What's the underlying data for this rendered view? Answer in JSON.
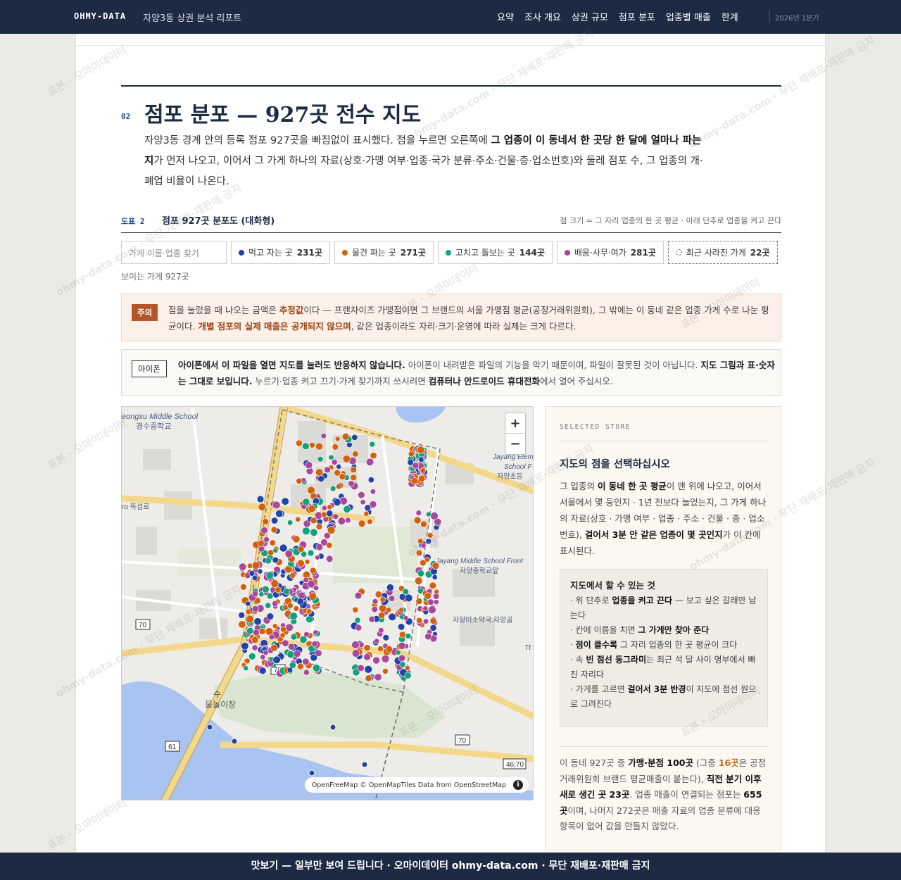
{
  "nav": {
    "brand": "OHMY-DATA",
    "report_title": "자양3동 상권 분석 리포트",
    "links": [
      "요약",
      "조사 개요",
      "상권 규모",
      "점포 분포",
      "업종별 매출",
      "한계"
    ],
    "period": "2026년 1분기"
  },
  "section": {
    "number": "02",
    "title": "점포 분포 — 927곳 전수 지도",
    "lede_1": "자양3동 경계 안의 등록 점포 927곳을 빠짐없이 표시했다. 점을 누르면 오른쪽에 ",
    "lede_bold": "그 업종이 이 동네서 한 곳당 한 달에 얼마나 파는지",
    "lede_2": "가 먼저 나오고, 이어서 그 가게 하나의 자료(상호·가맹 여부·업종·국가 분류·주소·건물·층·업소번호)와 둘레 점포 수, 그 업종의 개·폐업 비율이 나온다."
  },
  "figure": {
    "number": "도표 2",
    "title": "점포 927곳 분포도 (대화형)",
    "note": "점 크기 = 그 자리 업종의 한 곳 평균 · 아래 단추로 업종을 켜고 끈다"
  },
  "filters": {
    "search_placeholder": "가게 이름·업종 찾기",
    "chips": [
      {
        "label": "먹고 자는 곳",
        "count": "231곳",
        "color": "#2244aa"
      },
      {
        "label": "물건 파는 곳",
        "count": "271곳",
        "color": "#d0620e"
      },
      {
        "label": "고치고 돌보는 곳",
        "count": "144곳",
        "color": "#14a07a"
      },
      {
        "label": "배움·사무·여가",
        "count": "281곳",
        "color": "#a8489a"
      },
      {
        "label": "최근 사라진 가게",
        "count": "22곳",
        "color": "#666666"
      }
    ],
    "visible_count": "보이는 가게 927곳"
  },
  "warning": {
    "badge": "주의",
    "text_1": "점을 눌렀을 때 나오는 금액은 ",
    "bold_1": "추정값",
    "text_2": "이다 — 프랜차이즈 가맹점이면 그 브랜드의 서울 가맹점 평균(공정거래위원회), 그 밖에는 이 동네 같은 업종 가게 수로 나눈 평균이다. ",
    "bold_2": "개별 점포의 실제 매출은 공개되지 않으며",
    "text_3": ", 같은 업종이라도 자리·크기·운영에 따라 실제는 크게 다르다."
  },
  "ios": {
    "badge": "아이폰",
    "bold_1": "아이폰에서 이 파일을 열면 지도를 눌러도 반응하지 않습니다.",
    "text_1": " 아이폰이 내려받은 파일의 기능을 막기 때문이며, 파일이 잘못된 것이 아닙니다. ",
    "bold_2": "지도 그림과 표·숫자는 그대로 보입니다.",
    "text_2": " 누르기·업종 켜고 끄기·가게 찾기까지 쓰시려면 ",
    "bold_3": "컴퓨터나 안드로이드 휴대전화",
    "text_3": "에서 열어 주십시오."
  },
  "map": {
    "zoom_in": "+",
    "zoom_out": "−",
    "attribution": "OpenFreeMap © OpenMapTiles Data from OpenStreetMap",
    "labels": {
      "school_en": "eongsu Middle School",
      "school_kr": "경수중학교",
      "elem_en": "Jayang Elem",
      "elem_en2": "School F",
      "elem_kr": "자양초등",
      "mid_en": "Jayang Middle School Front",
      "mid_kr": "자양중학교앞",
      "bus_kr": "자양미소약국.자양골",
      "road_kr": "ro 뚝섬로",
      "park_kr1": "수",
      "park_kr2": "물놀이장",
      "road_70": "70",
      "road_61": "61",
      "road_4670": "46;70",
      "tt": "Tt"
    },
    "legend_colors": {
      "food": "#2244aa",
      "retail": "#d0620e",
      "service": "#14a07a",
      "office": "#a8489a"
    }
  },
  "panel": {
    "kicker": "SELECTED STORE",
    "title": "지도의 점을 선택하십시오",
    "desc_1": "그 업종의 ",
    "desc_b1": "이 동네 한 곳 평균",
    "desc_2": "이 맨 위에 나오고, 이어서 서울에서 몇 등인지 · 1년 전보다 늘었는지, 그 가게 하나의 자료(상호 · 가맹 여부 · 업종 · 주소 · 건물 · 층 · 업소번호), ",
    "desc_b2": "걸어서 3분 안 같은 업종이 몇 곳인지",
    "desc_3": "가 이 칸에 표시된다.",
    "howto_title": "지도에서 할 수 있는 것",
    "howto": [
      {
        "pre": "· 위 단추로 ",
        "bold": "업종을 켜고 끈다",
        "post": " — 보고 싶은 갈래만 남는다"
      },
      {
        "pre": "· 칸에 이름을 치면 ",
        "bold": "그 가게만 찾아 준다",
        "post": ""
      },
      {
        "pre": "· ",
        "bold": "점이 클수록",
        "post": " 그 자리 업종의 한 곳 평균이 크다"
      },
      {
        "pre": "· 속 ",
        "bold": "빈 점선 동그라미",
        "post": "는 최근 석 달 사이 명부에서 빠진 자리다"
      },
      {
        "pre": "· 가게를 고르면 ",
        "bold": "걸어서 3분 반경",
        "post": "이 지도에 점선 원으로 그려진다"
      }
    ],
    "stats_1": "이 동네 927곳 중 ",
    "stats_b1": "가맹·분점 100곳",
    "stats_2": " (그중 ",
    "stats_o": "16곳",
    "stats_3": "은 공정거래위원회 브랜드 평균매출이 붙는다), ",
    "stats_b2": "직전 분기 이후 새로 생긴 곳 23곳",
    "stats_4": ". 업종 매출이 연결되는 점포는 ",
    "stats_b3": "655곳",
    "stats_5": "이며, 나머지 272곳은 매출 자료의 업종 분류에 대응 항목이 없어 값을 만들지 않았다."
  },
  "watermark": "표본 · 오마이데이터",
  "watermark2": "ohmy-data.com · 무단 재배포·재판매 금지",
  "footer": "맛보기 — 일부만 보여 드립니다 · 오마이데이터 ohmy-data.com · 무단 재배포·재판매 금지"
}
